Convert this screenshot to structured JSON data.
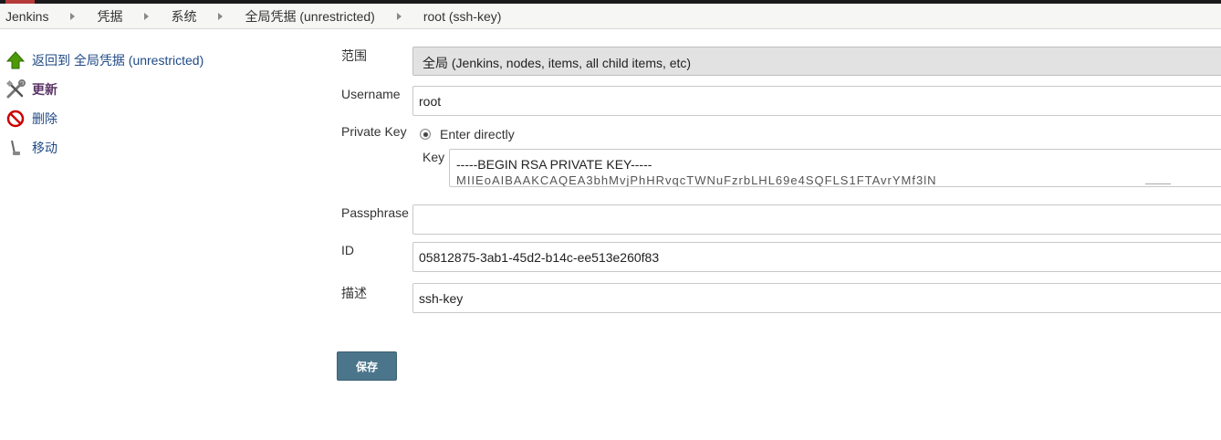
{
  "breadcrumb": [
    "Jenkins",
    "凭据",
    "系统",
    "全局凭据 (unrestricted)",
    "root (ssh-key)"
  ],
  "sidebar": {
    "items": [
      {
        "label": "返回到 全局凭据 (unrestricted)",
        "icon": "up-arrow-icon"
      },
      {
        "label": "更新",
        "icon": "tools-icon"
      },
      {
        "label": "删除",
        "icon": "no-entry-icon"
      },
      {
        "label": "移动",
        "icon": "move-icon"
      }
    ]
  },
  "form": {
    "scope": {
      "label": "范围",
      "value": "全局 (Jenkins, nodes, items, all child items, etc)"
    },
    "username": {
      "label": "Username",
      "value": "root"
    },
    "private_key": {
      "label": "Private Key",
      "option": "Enter directly",
      "key_label": "Key",
      "key_line1": "-----BEGIN RSA PRIVATE KEY-----",
      "key_line2": "MIIEoAIBAAKCAQEA3bhMvjPhHRvqcTWNuFzrbLHL69e4SQFLS1FTAvrYMf3lN"
    },
    "passphrase": {
      "label": "Passphrase",
      "value": ""
    },
    "id": {
      "label": "ID",
      "value": "05812875-3ab1-45d2-b14c-ee513e260f83"
    },
    "description": {
      "label": "描述",
      "value": "ssh-key"
    }
  },
  "save_label": "保存",
  "colors": {
    "accent": "#4b758b",
    "link": "#204a87",
    "breadcrumb_bg": "#f6f7f5"
  }
}
